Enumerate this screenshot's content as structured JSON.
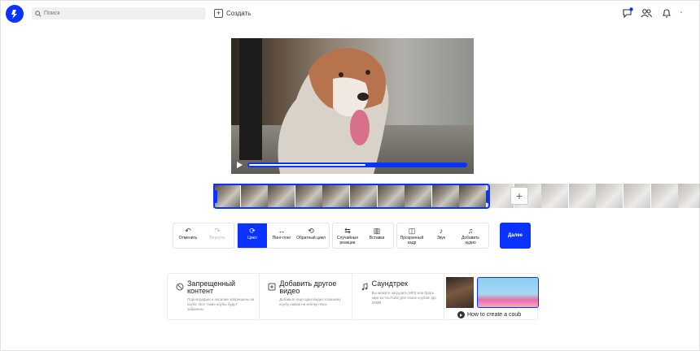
{
  "header": {
    "search_placeholder": "Поиск",
    "create_label": "Создать",
    "icons": [
      "chat-icon",
      "people-icon",
      "bell-icon"
    ]
  },
  "player": {
    "progress": 0.54,
    "accent_color": "#0a33ff"
  },
  "toolbar": {
    "undo": "Отменить",
    "redo": "Вернуть",
    "loop": "Цикл",
    "pingpong": "Пинг-понг",
    "reverse_loop": "Обратный цикл",
    "random_reactions": "Случайные реакции",
    "inserts": "Вставки",
    "transparent_frame": "Прозрачный кадр",
    "sound": "Звук",
    "add_audio": "Добавить аудио",
    "next": "Далее"
  },
  "tips": [
    {
      "title": "Запрещенный контент",
      "desc": "Порнография и насилие запрещены на коубе. Все такие коубы будут забанены"
    },
    {
      "title": "Добавить другое видео",
      "desc": "Добавьте еще одно видео к вашему коубу нажав на кнопку плюс"
    },
    {
      "title": "Саундтрек",
      "desc": "Вы можете загрузить MP3 или брать звук из YouTube для своих коубов. До 20MB"
    }
  ],
  "howto": {
    "caption": "How to create a coub"
  }
}
